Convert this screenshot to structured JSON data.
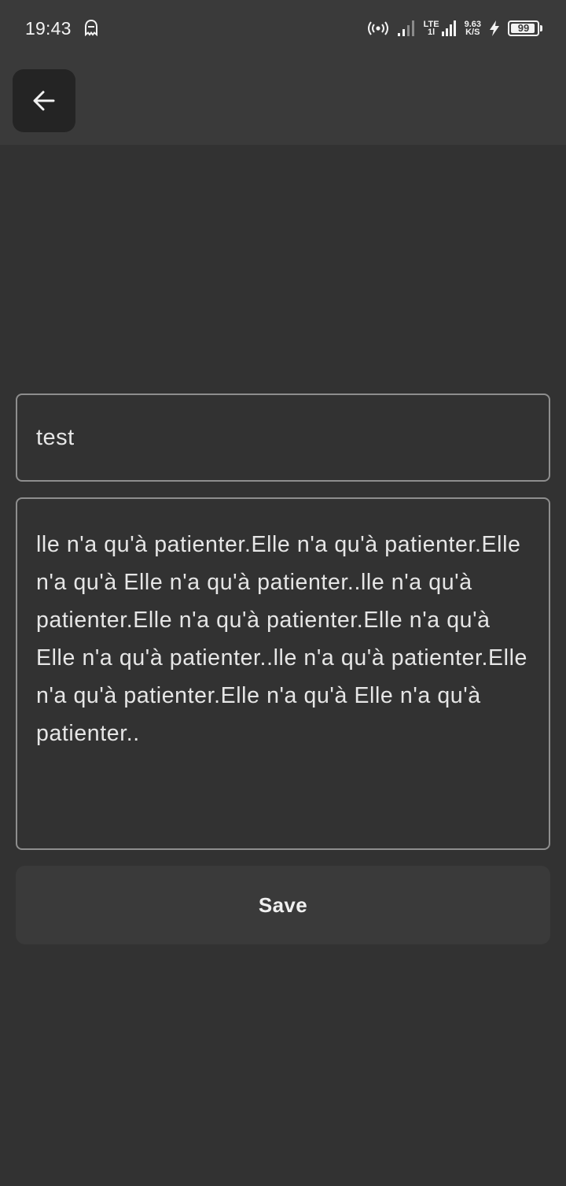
{
  "status_bar": {
    "time": "19:43",
    "ghost_icon": "ghost-icon",
    "hotspot_icon": "wifi-hotspot-icon",
    "signal_icon": "signal-bars-icon",
    "network_type": "LTE",
    "network_sub": "1l",
    "speed_value": "9.63",
    "speed_unit": "K/S",
    "charging_icon": "bolt-icon",
    "battery_level": "99"
  },
  "toolbar": {
    "back_icon": "arrow-left-icon"
  },
  "form": {
    "title_value": "test",
    "body_value": "lle n'a qu'à patienter.Elle n'a qu'à patienter.Elle n'a qu'à Elle n'a qu'à patienter..lle n'a qu'à patienter.Elle n'a qu'à patienter.Elle n'a qu'à Elle n'a qu'à patienter..lle n'a qu'à patienter.Elle n'a qu'à patienter.Elle n'a qu'à Elle n'a qu'à patienter..",
    "save_label": "Save"
  },
  "colors": {
    "background": "#323232",
    "app_bar": "#3a3a3a",
    "back_button": "#242424",
    "field_border": "#8e8e8e",
    "text": "#e6e6e6"
  }
}
